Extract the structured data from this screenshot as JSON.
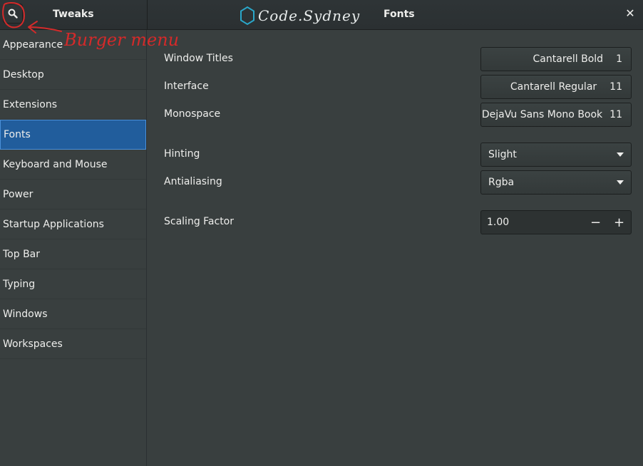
{
  "header": {
    "app_title": "Tweaks",
    "page_title": "Fonts",
    "watermark_text": "Code.Sydney"
  },
  "annotation": {
    "label": "Burger menu",
    "color": "#d42a2a"
  },
  "sidebar": {
    "items": [
      {
        "label": "Appearance"
      },
      {
        "label": "Desktop"
      },
      {
        "label": "Extensions"
      },
      {
        "label": "Fonts",
        "selected": true
      },
      {
        "label": "Keyboard and Mouse"
      },
      {
        "label": "Power"
      },
      {
        "label": "Startup Applications"
      },
      {
        "label": "Top Bar"
      },
      {
        "label": "Typing"
      },
      {
        "label": "Windows"
      },
      {
        "label": "Workspaces"
      }
    ]
  },
  "fonts": {
    "window_titles": {
      "label": "Window Titles",
      "font": "Cantarell Bold",
      "size": "1"
    },
    "interface": {
      "label": "Interface",
      "font": "Cantarell Regular",
      "size": "11"
    },
    "monospace": {
      "label": "Monospace",
      "font": "DejaVu Sans Mono Book",
      "size": "11"
    }
  },
  "rendering": {
    "hinting": {
      "label": "Hinting",
      "value": "Slight"
    },
    "antialiasing": {
      "label": "Antialiasing",
      "value": "Rgba"
    }
  },
  "scaling": {
    "label": "Scaling Factor",
    "value": "1.00",
    "decrement": "−",
    "increment": "+"
  },
  "colors": {
    "background": "#393f3f",
    "header": "#2e3436",
    "selection": "#215d9c",
    "watermark_accent": "#2aa7c9"
  }
}
